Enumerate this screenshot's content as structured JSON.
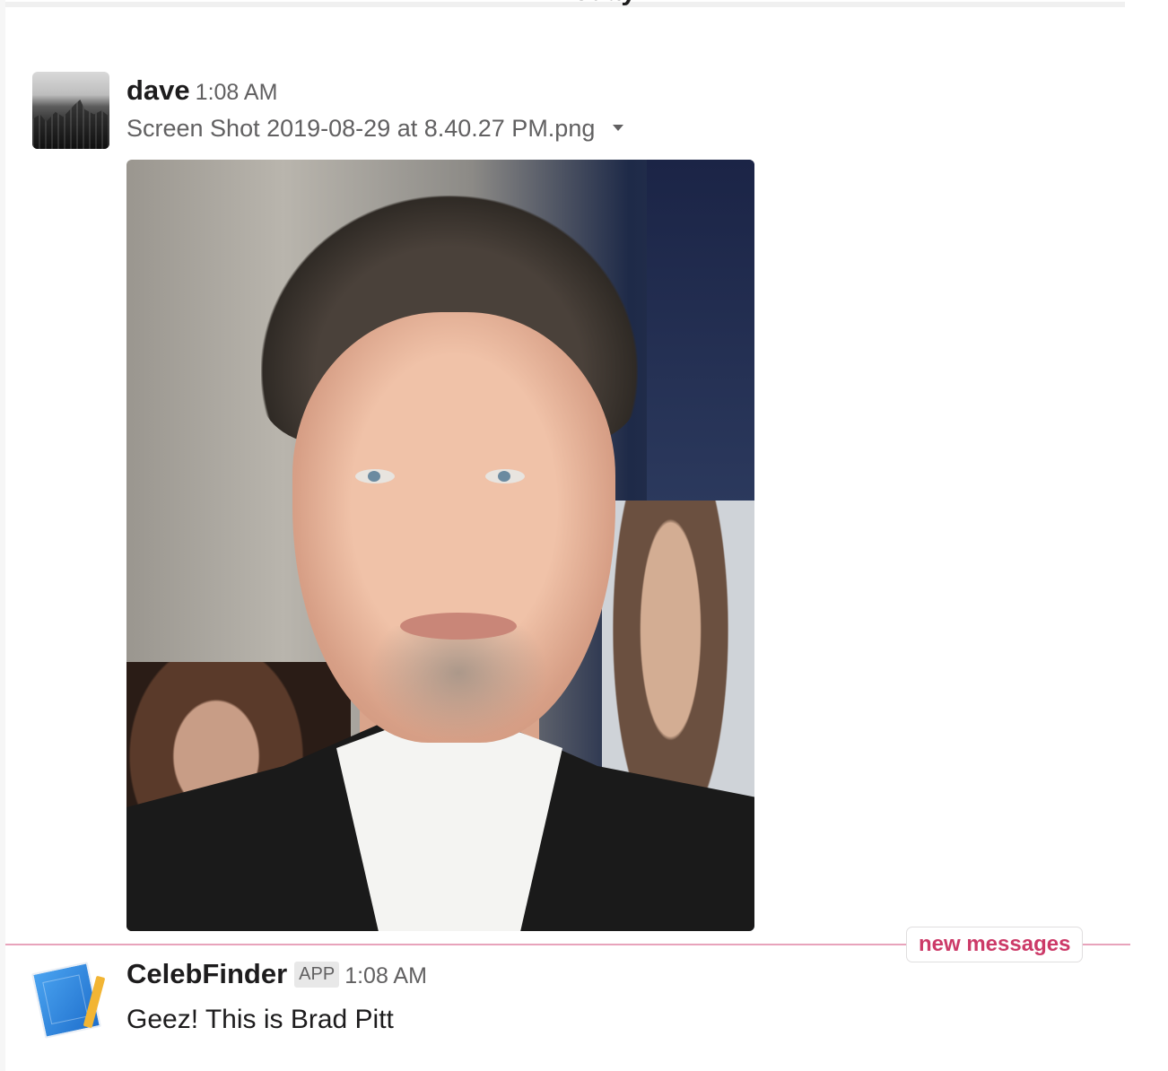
{
  "day_divider": {
    "label": "Today"
  },
  "messages": [
    {
      "sender": "dave",
      "time": "1:08 AM",
      "file": {
        "name": "Screen Shot 2019-08-29 at 8.40.27 PM.png"
      }
    },
    {
      "sender": "CelebFinder",
      "badge": "APP",
      "time": "1:08 AM",
      "text": "Geez! This is Brad Pitt"
    }
  ],
  "unread_divider": {
    "label": "new messages"
  },
  "colors": {
    "text": "#1d1c1d",
    "muted": "#616061",
    "new_messages": "#cc3a68",
    "divider_line": "#e8a3bb"
  },
  "icons": {
    "file_menu": "chevron-down-icon",
    "app_avatar": "book-pencil-icon"
  }
}
